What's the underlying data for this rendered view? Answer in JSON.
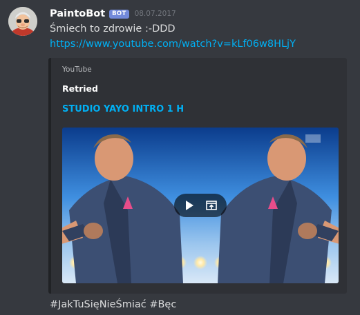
{
  "message": {
    "author": "PaintoBot",
    "bot_tag": "BOT",
    "timestamp": "08.07.2017",
    "text": "Śmiech to zdrowie :-DDD",
    "link": "https://www.youtube.com/watch?v=kLf06w8HLjY",
    "footer_text": "#JakTuSięNieŚmiać #Bęc"
  },
  "embed": {
    "provider": "YouTube",
    "author": "Retried",
    "title": "STUDIO YAYO INTRO 1 H",
    "icons": {
      "play": "play-icon",
      "external": "open-external-icon"
    }
  },
  "colors": {
    "background": "#36393f",
    "embed_background": "#2f3136",
    "link": "#00b0f4",
    "bot_tag": "#7289da",
    "timestamp": "#72767d"
  }
}
